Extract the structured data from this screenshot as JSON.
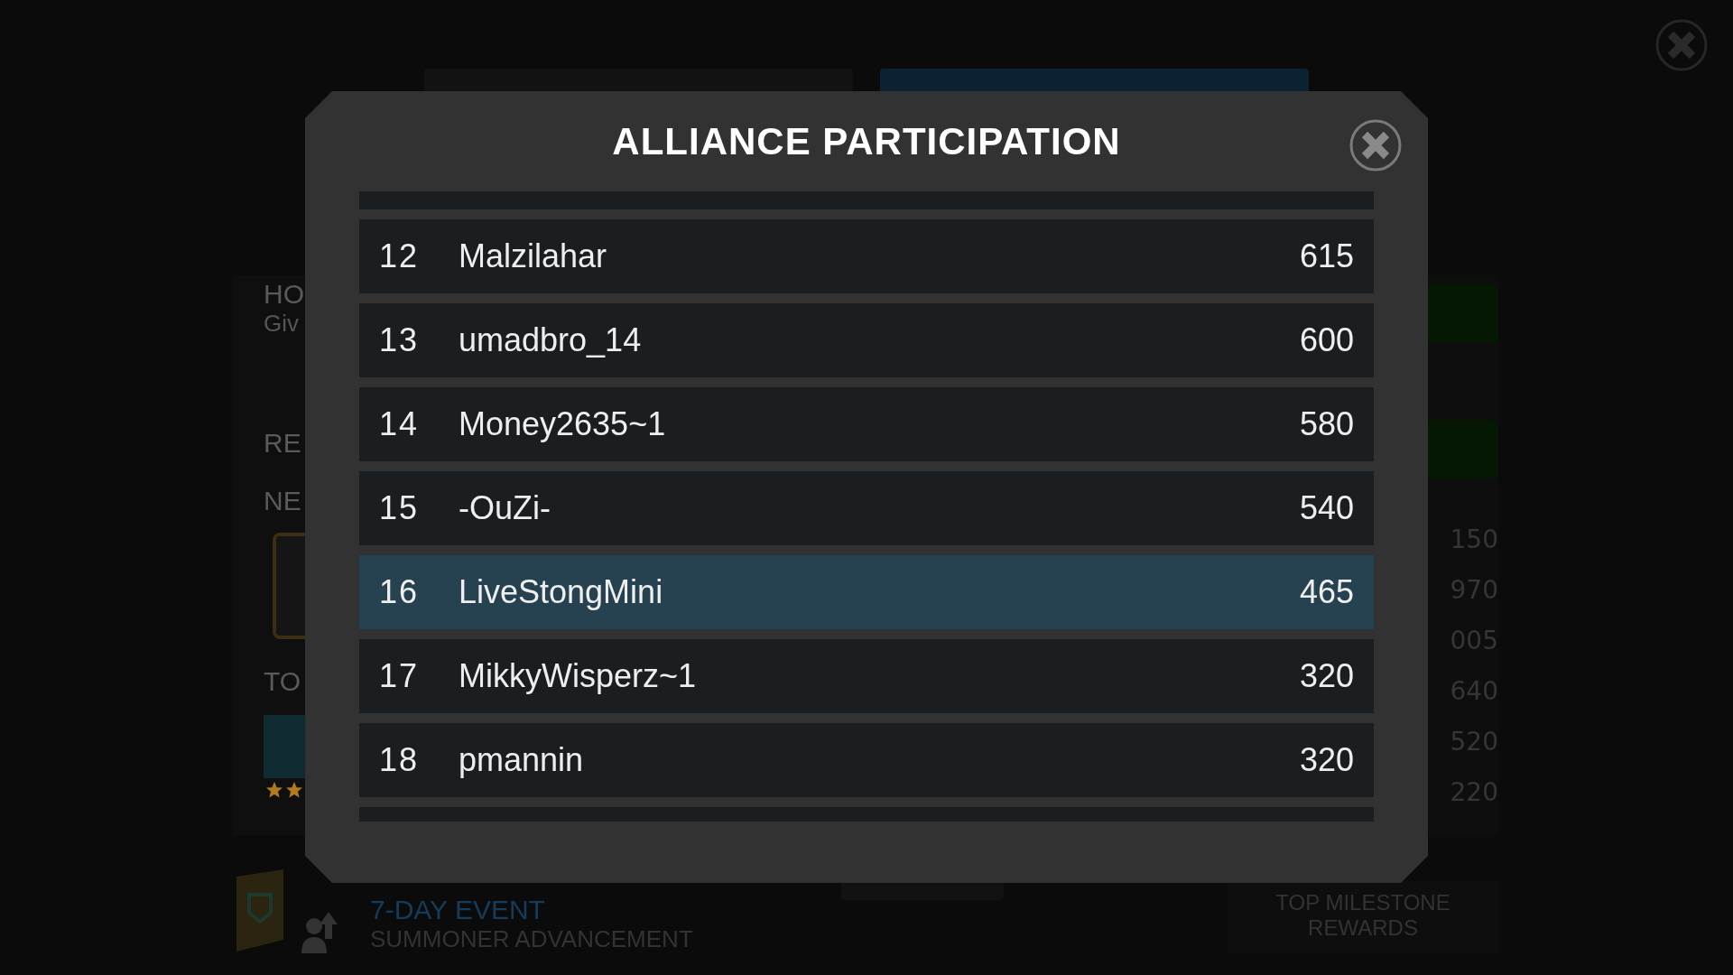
{
  "background": {
    "tabs": [
      {
        "selected": false
      },
      {
        "selected": true
      }
    ],
    "how_panel": {
      "title": "HO",
      "subtitle": "Giv"
    },
    "rewards_panel": {
      "title": "RE",
      "next_label": "NE",
      "top_label": "TO"
    },
    "scores": [
      "150",
      "970",
      "005",
      "640",
      "520",
      "220"
    ],
    "event": {
      "label": "7-DAY EVENT",
      "name": "SUMMONER ADVANCEMENT"
    },
    "milestone": "TOP MILESTONE REWARDS"
  },
  "dialog": {
    "title": "ALLIANCE PARTICIPATION",
    "rows": [
      {
        "rank": "12",
        "name": "Malzilahar",
        "score": "615",
        "selected": false
      },
      {
        "rank": "13",
        "name": "umadbro_14",
        "score": "600",
        "selected": false
      },
      {
        "rank": "14",
        "name": "Money2635~1",
        "score": "580",
        "selected": false
      },
      {
        "rank": "15",
        "name": "-OuZi-",
        "score": "540",
        "selected": false
      },
      {
        "rank": "16",
        "name": "LiveStongMini",
        "score": "465",
        "selected": true
      },
      {
        "rank": "17",
        "name": "MikkyWisperz~1",
        "score": "320",
        "selected": false
      },
      {
        "rank": "18",
        "name": "pmannin",
        "score": "320",
        "selected": false
      }
    ]
  }
}
